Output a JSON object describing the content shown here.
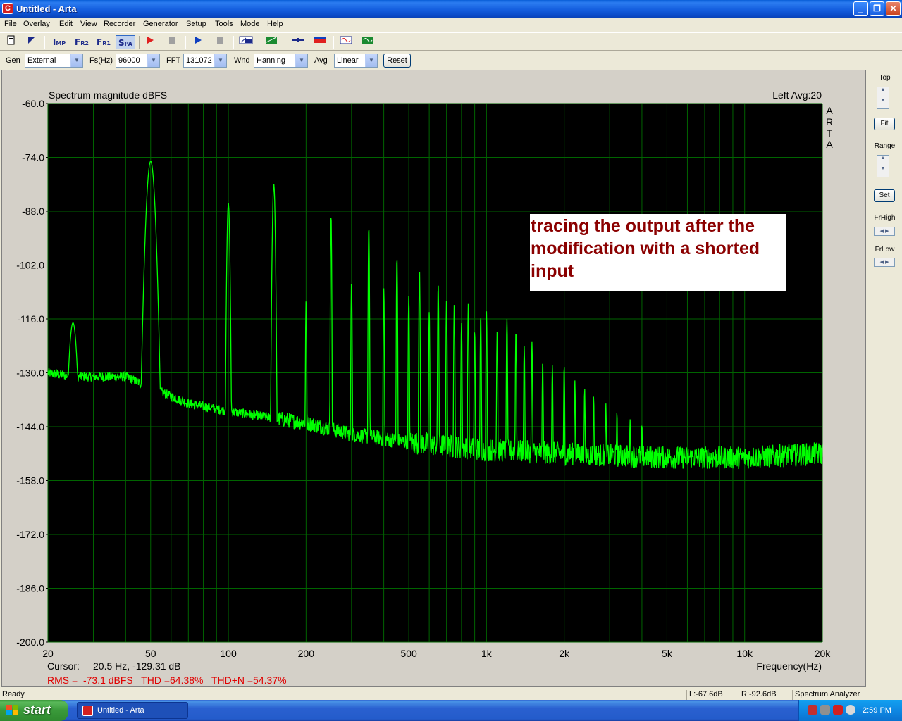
{
  "window": {
    "title": "Untitled - Arta",
    "app_icon": "arta-icon"
  },
  "menu": [
    "File",
    "Overlay",
    "Edit",
    "View",
    "Recorder",
    "Generator",
    "Setup",
    "Tools",
    "Mode",
    "Help"
  ],
  "toolbar": {
    "imp": "I",
    "imp_sub": "MP",
    "fr2": "F",
    "fr2_sub": "R2",
    "fr1": "F",
    "fr1_sub": "R1",
    "spa": "S",
    "spa_sub": "PA"
  },
  "controls": {
    "gen_label": "Gen",
    "gen_value": "External",
    "fs_label": "Fs(Hz)",
    "fs_value": "96000",
    "fft_label": "FFT",
    "fft_value": "131072",
    "wnd_label": "Wnd",
    "wnd_value": "Hanning",
    "avg_label": "Avg",
    "avg_value": "Linear",
    "reset_label": "Reset"
  },
  "graph": {
    "title": "Spectrum magnitude dBFS",
    "channel_avg": "Left  Avg:20",
    "watermark": [
      "A",
      "R",
      "T",
      "A"
    ],
    "annotation": [
      "tracing the output after the",
      "modification with a shorted",
      "input"
    ],
    "cursor_label": "Cursor:",
    "cursor_value": "20.5 Hz, -129.31 dB",
    "stats": "RMS =  -73.1 dBFS   THD =64.38%   THD+N =54.37%",
    "xlabel": "Frequency(Hz)"
  },
  "chart_data": {
    "type": "line",
    "title": "Spectrum magnitude dBFS",
    "xlabel": "Frequency(Hz)",
    "ylabel": "",
    "x_scale": "log",
    "xlim": [
      20,
      20000
    ],
    "ylim": [
      -200,
      -60
    ],
    "grid": true,
    "y_ticks": [
      "-60.0",
      "-74.0",
      "-88.0",
      "-102.0",
      "-116.0",
      "-130.0",
      "-144.0",
      "-158.0",
      "-172.0",
      "-186.0",
      "-200.0"
    ],
    "y_tick_values": [
      -60,
      -74,
      -88,
      -102,
      -116,
      -130,
      -144,
      -158,
      -172,
      -186,
      -200
    ],
    "x_ticks": [
      "20",
      "50",
      "100",
      "200",
      "500",
      "1k",
      "2k",
      "5k",
      "10k",
      "20k"
    ],
    "x_tick_values": [
      20,
      50,
      100,
      200,
      500,
      1000,
      2000,
      5000,
      10000,
      20000
    ],
    "line_color": "#00ff00",
    "background": "#000000",
    "grid_color": "#006400",
    "peaks": [
      {
        "f": 25,
        "db": -117
      },
      {
        "f": 50,
        "db": -75
      },
      {
        "f": 100,
        "db": -86
      },
      {
        "f": 150,
        "db": -81
      },
      {
        "f": 200,
        "db": -111
      },
      {
        "f": 250,
        "db": -89
      },
      {
        "f": 300,
        "db": -106
      },
      {
        "f": 350,
        "db": -92
      },
      {
        "f": 400,
        "db": -108
      },
      {
        "f": 450,
        "db": -100
      },
      {
        "f": 500,
        "db": -110
      },
      {
        "f": 550,
        "db": -103
      },
      {
        "f": 600,
        "db": -114
      },
      {
        "f": 650,
        "db": -107
      },
      {
        "f": 700,
        "db": -111
      },
      {
        "f": 750,
        "db": -112
      },
      {
        "f": 800,
        "db": -117
      },
      {
        "f": 850,
        "db": -112
      },
      {
        "f": 900,
        "db": -119
      },
      {
        "f": 950,
        "db": -115
      },
      {
        "f": 1000,
        "db": -114
      },
      {
        "f": 1100,
        "db": -119
      },
      {
        "f": 1200,
        "db": -116
      },
      {
        "f": 1300,
        "db": -119
      },
      {
        "f": 1400,
        "db": -123
      },
      {
        "f": 1500,
        "db": -122
      },
      {
        "f": 1650,
        "db": -127
      },
      {
        "f": 1800,
        "db": -128
      },
      {
        "f": 2000,
        "db": -128
      },
      {
        "f": 2200,
        "db": -132
      },
      {
        "f": 2400,
        "db": -134
      },
      {
        "f": 2600,
        "db": -136
      },
      {
        "f": 2900,
        "db": -138
      },
      {
        "f": 3200,
        "db": -140
      },
      {
        "f": 3600,
        "db": -142
      },
      {
        "f": 4000,
        "db": -143
      }
    ],
    "noise_floor": [
      {
        "f": 20,
        "db": -130
      },
      {
        "f": 25,
        "db": -131
      },
      {
        "f": 40,
        "db": -131
      },
      {
        "f": 70,
        "db": -138
      },
      {
        "f": 100,
        "db": -140
      },
      {
        "f": 200,
        "db": -143
      },
      {
        "f": 300,
        "db": -146
      },
      {
        "f": 500,
        "db": -148
      },
      {
        "f": 1000,
        "db": -150
      },
      {
        "f": 2000,
        "db": -151
      },
      {
        "f": 5000,
        "db": -152
      },
      {
        "f": 10000,
        "db": -152
      },
      {
        "f": 20000,
        "db": -151
      }
    ]
  },
  "side_panel": {
    "top_label": "Top",
    "fit_label": "Fit",
    "range_label": "Range",
    "set_label": "Set",
    "frhigh_label": "FrHigh",
    "frlow_label": "FrLow"
  },
  "status": {
    "ready": "Ready",
    "left_level": "L:-67.6dB",
    "right_level": "R:-92.6dB",
    "mode": "Spectrum Analyzer"
  },
  "taskbar": {
    "start": "start",
    "task": "Untitled - Arta",
    "clock": "2:59 PM"
  }
}
